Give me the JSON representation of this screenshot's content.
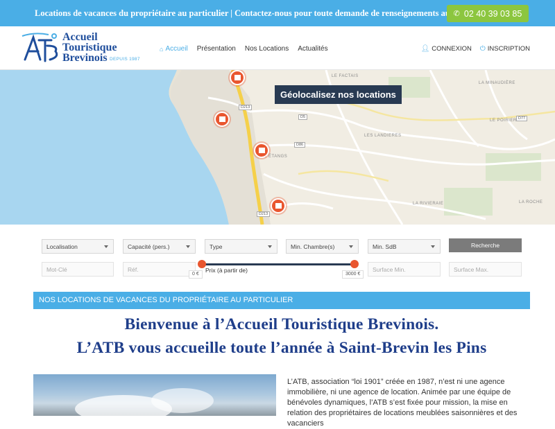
{
  "topbar": {
    "text": "Locations de vacances du propriétaire au particulier | Contactez-nous pour toute demande de renseignements au",
    "phone": "02 40 39 03 85",
    "phone_icon": "phone-icon"
  },
  "logo": {
    "line1": "Accueil",
    "line2": "Touristique",
    "line3": "Brevinois",
    "depuis": "DEPUIS 1987"
  },
  "nav": {
    "items": [
      {
        "label": "Accueil",
        "icon": "home-icon",
        "active": true
      },
      {
        "label": "Présentation"
      },
      {
        "label": "Nos Locations"
      },
      {
        "label": "Actualités"
      }
    ]
  },
  "auth": {
    "login": "CONNEXION",
    "register": "INSCRIPTION"
  },
  "map": {
    "title": "Géolocalisez nos locations",
    "labels": [
      "LE FACTAIS",
      "LA MINAUDIÈRE",
      "LES LANDIERES",
      "LE POIRIER",
      "LA RIVIERAIE",
      "LES ÉTANGS",
      "LA ROCHE"
    ],
    "roads": [
      "D213",
      "D5",
      "D86",
      "D213",
      "D77"
    ]
  },
  "search": {
    "localisation": "Localisation",
    "capacite": "Capacité (pers.)",
    "type": "Type",
    "min_chambre": "Min. Chambre(s)",
    "min_sdb": "Min. SdB",
    "button": "Recherche",
    "mot_cle": "Mot-Clé",
    "ref": "Réf.",
    "prix_label": "Prix (à partir de)",
    "prix_min": "0 €",
    "prix_max": "3000 €",
    "surface_min": "Surface Min.",
    "surface_max": "Surface Max."
  },
  "section": {
    "banner": "NOS LOCATIONS DE VACANCES DU PROPRIÉTAIRE AU PARTICULIER",
    "welcome_line1": "Bienvenue à l’Accueil Touristique Brevinois.",
    "welcome_line2": "L’ATB vous accueille toute l’année à Saint-Brevin les Pins",
    "intro": "L’ATB, association “loi 1901” créée en 1987, n’est ni une agence immobilière, ni une agence de location. Animée par une équipe de bénévoles dynamiques, l’ATB s’est fixée pour mission, la mise en relation des propriétaires de locations meublées saisonnières et des vacanciers"
  },
  "colors": {
    "topbar": "#4aaee6",
    "phone_button": "#8cc63f",
    "accent_orange": "#e9562f",
    "navy": "#283a52",
    "title_blue": "#1f3e8a"
  }
}
